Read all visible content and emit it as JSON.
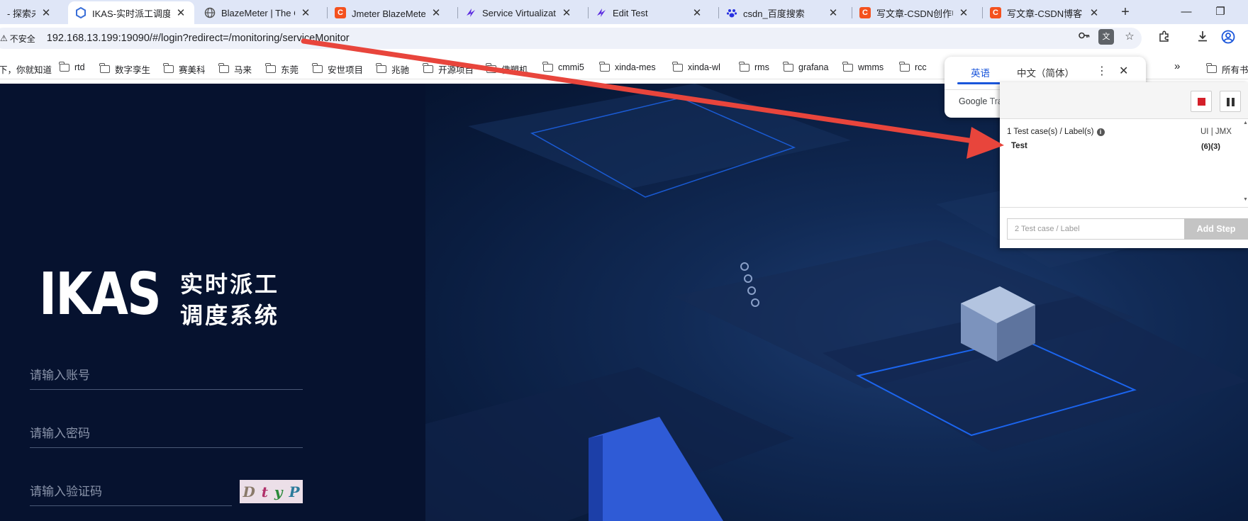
{
  "tabs": [
    {
      "title": "- 探索未知",
      "icon": "none",
      "active": false
    },
    {
      "title": "IKAS-实时派工调度系统",
      "icon": "ikas",
      "active": true
    },
    {
      "title": "BlazeMeter | The Continuous Testing Platform",
      "icon": "globe",
      "active": false
    },
    {
      "title": "Jmeter BlazeMeter插件",
      "icon": "csdn",
      "active": false
    },
    {
      "title": "Service Virtualization",
      "icon": "blaze",
      "active": false
    },
    {
      "title": "Edit Test",
      "icon": "blaze",
      "active": false
    },
    {
      "title": "csdn_百度搜索",
      "icon": "baidu",
      "active": false
    },
    {
      "title": "写文章-CSDN创作中心",
      "icon": "csdn",
      "active": false
    },
    {
      "title": "写文章-CSDN博客",
      "icon": "csdn",
      "active": false
    }
  ],
  "address_bar": {
    "security_label": "不安全",
    "url": "192.168.13.199:19090/#/login?redirect=/monitoring/serviceMonitor"
  },
  "bookmarks": {
    "first_label": "下，你就知道",
    "items": [
      "rtd",
      "数字孪生",
      "赛美科",
      "马来",
      "东莞",
      "安世项目",
      "兆驰",
      "开源项目",
      "佛塑机",
      "cmmi5",
      "xinda-mes",
      "xinda-wl",
      "rms",
      "grafana",
      "wmms",
      "rcc"
    ],
    "more_label": "»",
    "all_bookmarks_label": "所有书签"
  },
  "translate_popup": {
    "source_lang": "英语",
    "target_lang": "中文（简体）",
    "brand": "Google",
    "brand_suffix": "Translate"
  },
  "recorder": {
    "count_label": "1 Test case(s) / Label(s)",
    "format_label": "UI | JMX",
    "rows": [
      {
        "name": "Test",
        "counts": "(6)(3)"
      }
    ],
    "input_placeholder": "2 Test case / Label",
    "add_button": "Add Step"
  },
  "login": {
    "logo_text": "IKAS",
    "logo_cn_line1": "实时派工",
    "logo_cn_line2": "调度系统",
    "account_placeholder": "请输入账号",
    "password_placeholder": "请输入密码",
    "captcha_placeholder": "请输入验证码",
    "captcha_chars": [
      "D",
      "t",
      "y",
      "P"
    ]
  },
  "colors": {
    "tabstrip_bg": "#dfe6f7",
    "login_bg": "#06122f",
    "hero_glow": "#1d6cff",
    "arrow": "#e8453c",
    "accent_blue": "#1a56db",
    "stop_red": "#d4202a"
  }
}
